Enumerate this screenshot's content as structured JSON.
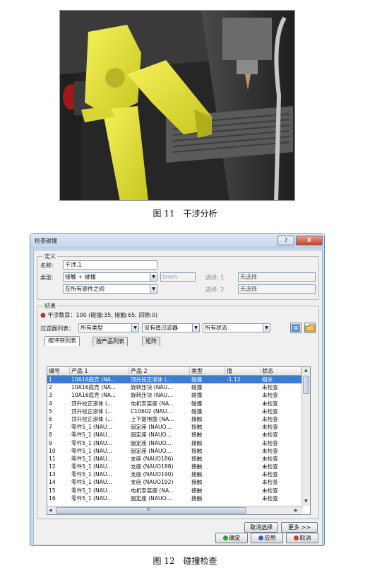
{
  "figure11": {
    "caption": "图 11　干涉分析"
  },
  "figure12": {
    "caption": "图 12　碰撞检查"
  },
  "dialog": {
    "title": "检查碰撞",
    "help_label": "?",
    "close_label": "X",
    "definition": {
      "group_label": "定义",
      "name_label": "名称:",
      "name_value": "干涉.1",
      "type_label": "类型:",
      "type_value": "接触 + 碰撞",
      "clearance_value": "0mm",
      "scope_value": "在所有部件之间",
      "selection1_label": "选择: 1",
      "selection1_value": "无选择",
      "selection2_label": "选择: 2",
      "selection2_value": "无选择"
    },
    "results": {
      "group_label": "结果",
      "summary": "干涉数目：100 (碰撞:35, 接触:65, 间隙:0)",
      "filter_label": "过滤器列表：",
      "filter1": "所有类型",
      "filter2": "没有值过滤器",
      "filter3": "所有状态"
    },
    "tabs": [
      "按冲突列表",
      "按产品列表",
      "矩阵"
    ],
    "table": {
      "columns": [
        "编号",
        "产品 1",
        "产品 2",
        "类型",
        "值",
        "状态"
      ],
      "rows": [
        [
          "1",
          "10A16底壳 (NA...",
          "顶升校正滚体 (...",
          "碰撞",
          "-1.12",
          "相关"
        ],
        [
          "2",
          "10A16底壳 (NA...",
          "旋转压块 (NAU...",
          "碰撞",
          "",
          "未检查"
        ],
        [
          "3",
          "10A16底壳 (NA...",
          "旋转压块 (NAU...",
          "碰撞",
          "",
          "未检查"
        ],
        [
          "4",
          "顶升校正滚体 (...",
          "电机安装座 (NA...",
          "碰撞",
          "",
          "未检查"
        ],
        [
          "5",
          "顶升校正滚体 (...",
          "C10602 (NAU...",
          "碰撞",
          "",
          "未检查"
        ],
        [
          "6",
          "顶升校正滚体 (...",
          "上下提地面 (NA...",
          "接触",
          "",
          "未检查"
        ],
        [
          "7",
          "零件5_1 (NAU...",
          "固定座 (NAUO...",
          "接触",
          "",
          "未检查"
        ],
        [
          "8",
          "零件5_1 (NAU...",
          "固定座 (NAUO...",
          "接触",
          "",
          "未检查"
        ],
        [
          "9",
          "零件5_1 (NAU...",
          "固定座 (NAUO...",
          "接触",
          "",
          "未检查"
        ],
        [
          "10",
          "零件5_1 (NAU...",
          "固定座 (NAUO...",
          "接触",
          "",
          "未检查"
        ],
        [
          "11",
          "零件5_1 (NAU...",
          "支座 (NAUO186)",
          "接触",
          "",
          "未检查"
        ],
        [
          "12",
          "零件5_1 (NAU...",
          "支座 (NAUO188)",
          "接触",
          "",
          "未检查"
        ],
        [
          "13",
          "零件5_1 (NAU...",
          "支座 (NAUO190)",
          "接触",
          "",
          "未检查"
        ],
        [
          "14",
          "零件5_1 (NAU...",
          "支座 (NAUO192)",
          "接触",
          "",
          "未检查"
        ],
        [
          "15",
          "零件5_1 (NAU...",
          "电机安装座 (NA...",
          "接触",
          "",
          "未检查"
        ],
        [
          "16",
          "零件5_1 (NAU...",
          "固定座 (NAUO...",
          "接触",
          "",
          "未检查"
        ]
      ],
      "selected_row": 0
    },
    "hscroll_label": "III",
    "buttons": {
      "clear_selection": "取消选择",
      "more": "更多 >>",
      "ok": "确定",
      "apply": "应用",
      "cancel": "取消"
    },
    "colors": {
      "selection": "#3d7bd3",
      "ok_dot": "#2f9e2f",
      "apply_dot": "#2f66c4",
      "cancel_dot": "#d23a2a"
    }
  }
}
